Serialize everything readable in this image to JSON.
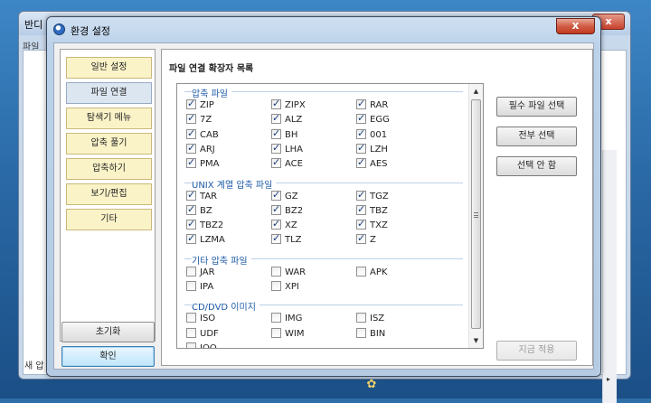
{
  "background_window": {
    "title": "반디",
    "menu_first": "파일",
    "status_left": "새 압",
    "partial_label": "일"
  },
  "dialog": {
    "title": "환경 설정",
    "close_label": "x"
  },
  "nav": [
    {
      "label": "일반 설정",
      "active": false
    },
    {
      "label": "파일 연결",
      "active": true
    },
    {
      "label": "탐색기 메뉴",
      "active": false
    },
    {
      "label": "압축 풀기",
      "active": false
    },
    {
      "label": "압축하기",
      "active": false
    },
    {
      "label": "보기/편집",
      "active": false
    },
    {
      "label": "기타",
      "active": false
    }
  ],
  "left_buttons": {
    "reset": "초기화",
    "ok": "확인"
  },
  "panel": {
    "title": "파일 연결 확장자 목록"
  },
  "groups": [
    {
      "title": "압축 파일",
      "items": [
        {
          "label": "ZIP",
          "checked": true
        },
        {
          "label": "ZIPX",
          "checked": true
        },
        {
          "label": "RAR",
          "checked": true
        },
        {
          "label": "7Z",
          "checked": true
        },
        {
          "label": "ALZ",
          "checked": true
        },
        {
          "label": "EGG",
          "checked": true
        },
        {
          "label": "CAB",
          "checked": true
        },
        {
          "label": "BH",
          "checked": true
        },
        {
          "label": "001",
          "checked": true
        },
        {
          "label": "ARJ",
          "checked": true
        },
        {
          "label": "LHA",
          "checked": true
        },
        {
          "label": "LZH",
          "checked": true
        },
        {
          "label": "PMA",
          "checked": true
        },
        {
          "label": "ACE",
          "checked": true
        },
        {
          "label": "AES",
          "checked": true
        }
      ]
    },
    {
      "title": "UNIX 계열 압축 파일",
      "items": [
        {
          "label": "TAR",
          "checked": true
        },
        {
          "label": "GZ",
          "checked": true
        },
        {
          "label": "TGZ",
          "checked": true
        },
        {
          "label": "BZ",
          "checked": true
        },
        {
          "label": "BZ2",
          "checked": true
        },
        {
          "label": "TBZ",
          "checked": true
        },
        {
          "label": "TBZ2",
          "checked": true
        },
        {
          "label": "XZ",
          "checked": true
        },
        {
          "label": "TXZ",
          "checked": true
        },
        {
          "label": "LZMA",
          "checked": true
        },
        {
          "label": "TLZ",
          "checked": true
        },
        {
          "label": "Z",
          "checked": true
        }
      ]
    },
    {
      "title": "기타 압축 파일",
      "items": [
        {
          "label": "JAR",
          "checked": false
        },
        {
          "label": "WAR",
          "checked": false
        },
        {
          "label": "APK",
          "checked": false
        },
        {
          "label": "IPA",
          "checked": false
        },
        {
          "label": "XPI",
          "checked": false
        }
      ]
    },
    {
      "title": "CD/DVD 이미지",
      "items": [
        {
          "label": "ISO",
          "checked": false
        },
        {
          "label": "IMG",
          "checked": false
        },
        {
          "label": "ISZ",
          "checked": false
        },
        {
          "label": "UDF",
          "checked": false
        },
        {
          "label": "WIM",
          "checked": false
        },
        {
          "label": "BIN",
          "checked": false
        },
        {
          "label": "IOO",
          "checked": false
        }
      ]
    }
  ],
  "right_buttons": {
    "select_required": "필수 파일 선택",
    "select_all": "전부 선택",
    "select_none": "선택 안 함",
    "apply_now": "지금 적용"
  }
}
